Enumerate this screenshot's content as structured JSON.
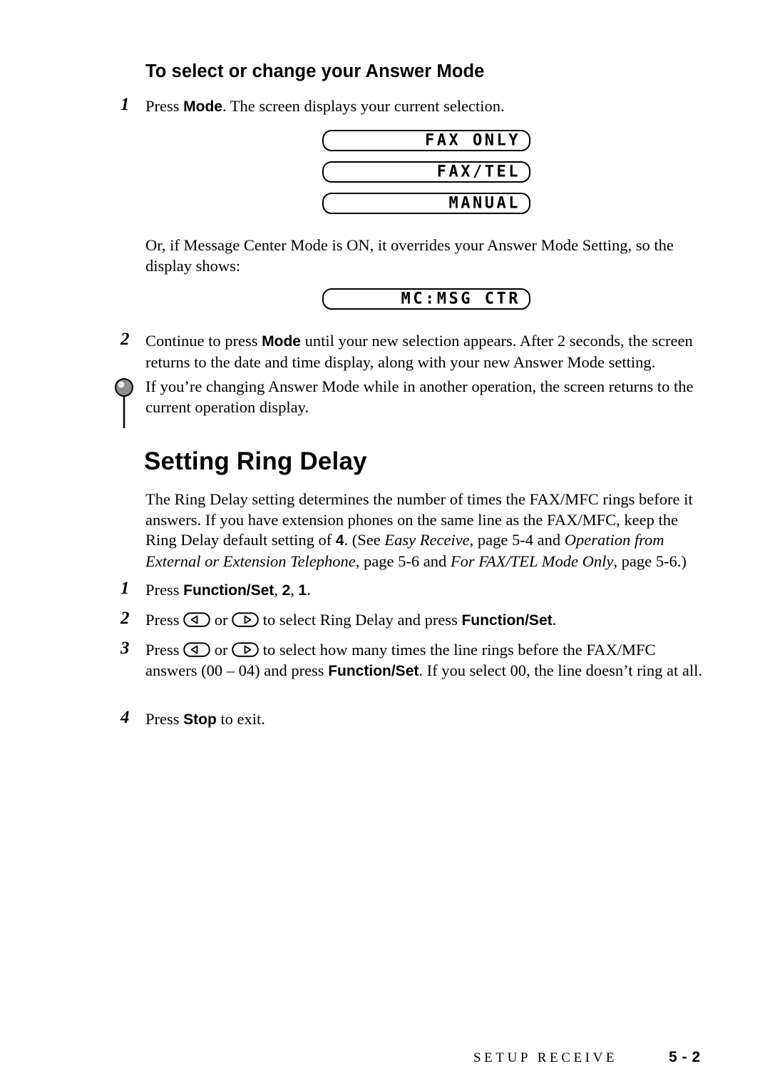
{
  "document": {
    "subheading": "To select or change your Answer Mode",
    "section_heading": "Setting Ring Delay"
  },
  "answer_mode": {
    "step1_num": "1",
    "step1_text_a": "Press ",
    "step1_bold": "Mode",
    "step1_text_b": ". The screen displays your current selection.",
    "lcd_options": [
      "FAX ONLY",
      "FAX/TEL",
      "MANUAL"
    ],
    "note_text": "Or, if Message Center Mode is ON, it overrides your Answer Mode Setting, so the display shows:",
    "lcd_mc": "MC:MSG CTR",
    "step2_num": "2",
    "step2_text_a": "Continue to press ",
    "step2_bold": "Mode",
    "step2_text_b": " until your new selection appears. After 2 seconds, the screen returns to the date and time display, along with your new Answer Mode setting.",
    "tip_text": "If you’re changing Answer Mode while in another operation, the screen returns to the current operation display."
  },
  "ring_delay": {
    "intro_a": "The Ring Delay setting determines the number of times the FAX/MFC rings before it answers.  If you have extension phones on the same line as the FAX/MFC, keep the Ring Delay default setting of ",
    "intro_bold_4": "4",
    "intro_b": ". (See ",
    "intro_italic_1": "Easy Receive",
    "intro_c": ", page 5-4 and ",
    "intro_italic_2": "Operation from External or Extension Telephone",
    "intro_d": ", page 5-6 and ",
    "intro_italic_3": "For FAX/TEL Mode Only",
    "intro_e": ", page 5-6.)",
    "step1_num": "1",
    "step1_a": "Press ",
    "step1_bold": "Function/Set",
    "step1_b": ", ",
    "step1_bold2": "2",
    "step1_c": ", ",
    "step1_bold3": "1",
    "step1_d": ".",
    "step2_num": "2",
    "step2_a": "Press ",
    "step2_or": " or ",
    "step2_b": " to select Ring Delay and press ",
    "step2_bold": "Function/Set",
    "step2_c": ".",
    "step3_num": "3",
    "step3_a": "Press ",
    "step3_or": " or ",
    "step3_b": " to select how many times the line rings before the FAX/MFC answers (00 – 04) and press ",
    "step3_bold": "Function/Set",
    "step3_c": ". If you select 00, the line doesn’t ring at all.",
    "step4_num": "4",
    "step4_a": "Press ",
    "step4_bold": "Stop",
    "step4_b": " to exit."
  },
  "footer": {
    "section": "SETUP RECEIVE",
    "page": "5 - 2"
  }
}
